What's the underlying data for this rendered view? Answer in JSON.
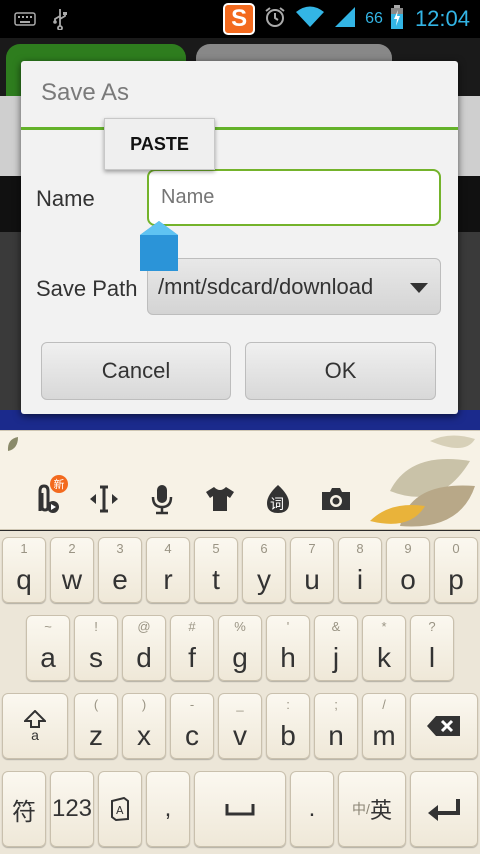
{
  "status": {
    "battery_percent": "66",
    "clock": "12:04",
    "sogou_label": "S"
  },
  "dialog": {
    "title": "Save As",
    "name_label": "Name",
    "name_placeholder": "Name",
    "name_value": "",
    "path_label": "Save Path",
    "path_value": "/mnt/sdcard/download",
    "cancel_label": "Cancel",
    "ok_label": "OK"
  },
  "paste_popup": {
    "label": "PASTE"
  },
  "ime_toolbar": {
    "items": [
      "attach-new-icon",
      "cursor-move-icon",
      "microphone-icon",
      "tshirt-icon",
      "word-icon",
      "camera-icon",
      "leaves-decoration"
    ],
    "new_badge": "新",
    "word_glyph": "词"
  },
  "keyboard": {
    "row1": [
      {
        "hint": "1",
        "key": "q"
      },
      {
        "hint": "2",
        "key": "w"
      },
      {
        "hint": "3",
        "key": "e"
      },
      {
        "hint": "4",
        "key": "r"
      },
      {
        "hint": "5",
        "key": "t"
      },
      {
        "hint": "6",
        "key": "y"
      },
      {
        "hint": "7",
        "key": "u"
      },
      {
        "hint": "8",
        "key": "i"
      },
      {
        "hint": "9",
        "key": "o"
      },
      {
        "hint": "0",
        "key": "p"
      }
    ],
    "row2": [
      {
        "hint": "~",
        "key": "a"
      },
      {
        "hint": "!",
        "key": "s"
      },
      {
        "hint": "@",
        "key": "d"
      },
      {
        "hint": "#",
        "key": "f"
      },
      {
        "hint": "%",
        "key": "g"
      },
      {
        "hint": "'",
        "key": "h"
      },
      {
        "hint": "&",
        "key": "j"
      },
      {
        "hint": "*",
        "key": "k"
      },
      {
        "hint": "?",
        "key": "l"
      }
    ],
    "row3": [
      {
        "hint": "(",
        "key": "z"
      },
      {
        "hint": ")",
        "key": "x"
      },
      {
        "hint": "-",
        "key": "c"
      },
      {
        "hint": "_",
        "key": "v"
      },
      {
        "hint": ":",
        "key": "b"
      },
      {
        "hint": ";",
        "key": "n"
      },
      {
        "hint": "/",
        "key": "m"
      }
    ],
    "shift_sub": "a",
    "symbol_key": "符",
    "num_key": "123",
    "comma_key": ",",
    "period_key": ".",
    "lang_key_cn": "中/",
    "lang_key_en": "英"
  }
}
